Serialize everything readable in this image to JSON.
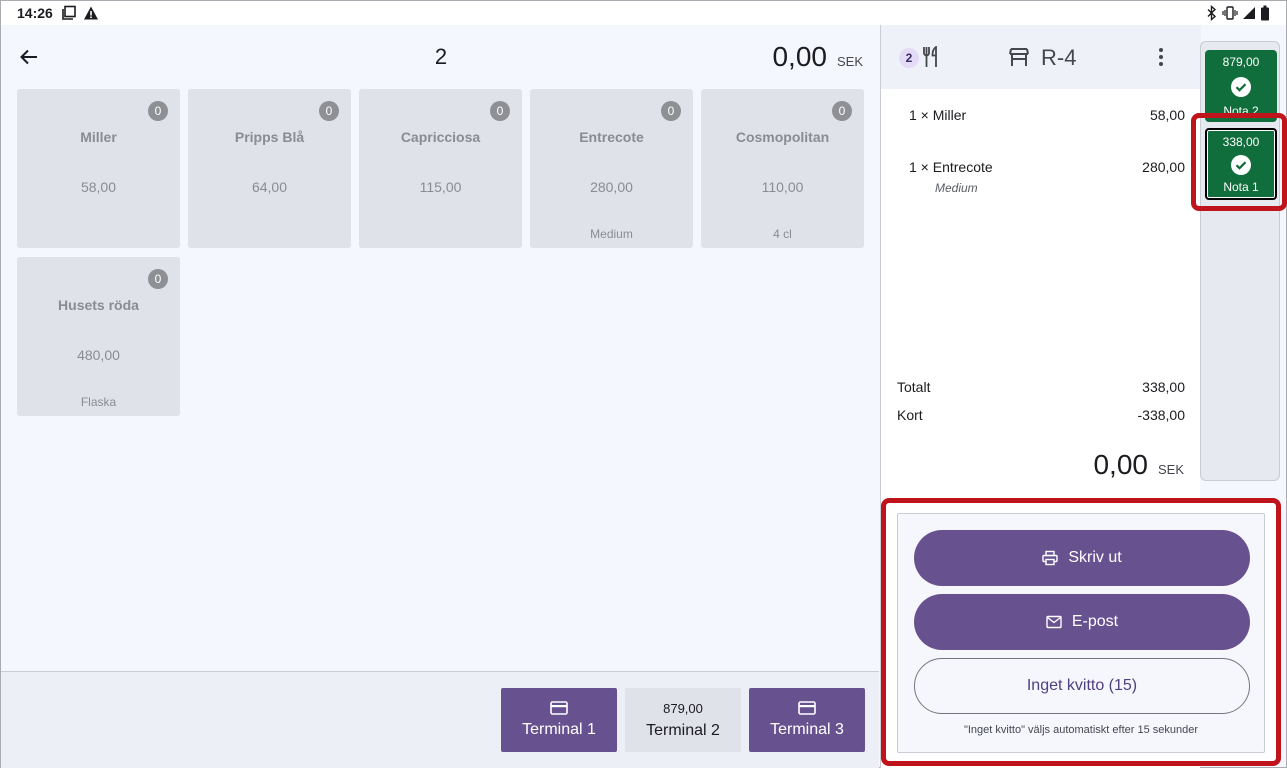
{
  "status_bar": {
    "time": "14:26"
  },
  "header": {
    "order_number": "2",
    "total": "0,00",
    "currency": "SEK"
  },
  "products": [
    {
      "name": "Miller",
      "price": "58,00",
      "count": "0",
      "note": ""
    },
    {
      "name": "Pripps Blå",
      "price": "64,00",
      "count": "0",
      "note": ""
    },
    {
      "name": "Capricciosa",
      "price": "115,00",
      "count": "0",
      "note": ""
    },
    {
      "name": "Entrecote",
      "price": "280,00",
      "count": "0",
      "note": "Medium"
    },
    {
      "name": "Cosmopolitan",
      "price": "110,00",
      "count": "0",
      "note": "4 cl"
    },
    {
      "name": "Husets röda",
      "price": "480,00",
      "count": "0",
      "note": "Flaska"
    }
  ],
  "terminals": [
    {
      "label": "Terminal 1",
      "amount": "",
      "style": "purple"
    },
    {
      "label": "Terminal 2",
      "amount": "879,00",
      "style": "gray"
    },
    {
      "label": "Terminal 3",
      "amount": "",
      "style": "purple"
    }
  ],
  "bill": {
    "guest_count": "2",
    "table": "R-4",
    "lines": [
      {
        "qty": "1 ×",
        "name": "Miller",
        "price": "58,00",
        "modifier": ""
      },
      {
        "qty": "1 ×",
        "name": "Entrecote",
        "price": "280,00",
        "modifier": "Medium"
      }
    ],
    "total_label": "Totalt",
    "total_value": "338,00",
    "card_label": "Kort",
    "card_value": "-338,00",
    "remaining": "0,00",
    "currency": "SEK"
  },
  "notas": [
    {
      "amount": "879,00",
      "label": "Nota 2",
      "selected": false
    },
    {
      "amount": "338,00",
      "label": "Nota 1",
      "selected": true
    }
  ],
  "receipt": {
    "print_label": "Skriv ut",
    "email_label": "E-post",
    "none_label": "Inget kvitto (15)",
    "auto_note": "\"Inget kvitto\" väljs automatiskt efter 15 sekunder"
  },
  "colors": {
    "primary": "#67528f",
    "nota_green": "#0f6e3b",
    "highlight": "#c0141c"
  }
}
